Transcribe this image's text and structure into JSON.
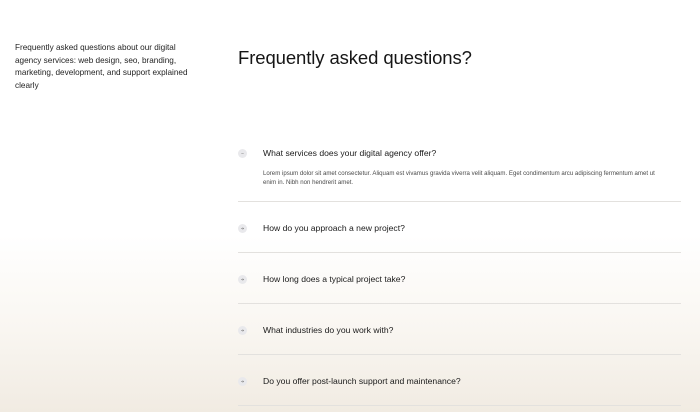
{
  "intro": {
    "text": "Frequently asked questions about our digital agency services: web design, seo, branding, marketing, development, and support explained clearly"
  },
  "faq": {
    "title": "Frequently asked questions?",
    "items": [
      {
        "question": "What services does your digital agency offer?",
        "answer": "Lorem ipsum dolor sit amet consectetur. Aliquam est vivamus gravida viverra velit aliquam. Eget condimentum arcu adipiscing fermentum amet ut enim in. Nibh non hendrerit amet.",
        "expanded": true,
        "icon": "minus-icon"
      },
      {
        "question": "How do you approach a new project?",
        "expanded": false,
        "icon": "arrow-right-icon"
      },
      {
        "question": "How long does a typical project take?",
        "expanded": false,
        "icon": "arrow-right-icon"
      },
      {
        "question": "What industries do you work with?",
        "expanded": false,
        "icon": "arrow-right-icon"
      },
      {
        "question": "Do you offer post-launch support and maintenance?",
        "expanded": false,
        "icon": "arrow-right-icon"
      }
    ]
  },
  "colors": {
    "text": "#1c1c1c",
    "muted_text": "#4a4a4a",
    "divider": "#e3e1de",
    "icon_bg": "#e9e9ec",
    "gradient_bottom": "#f1ebe2"
  }
}
